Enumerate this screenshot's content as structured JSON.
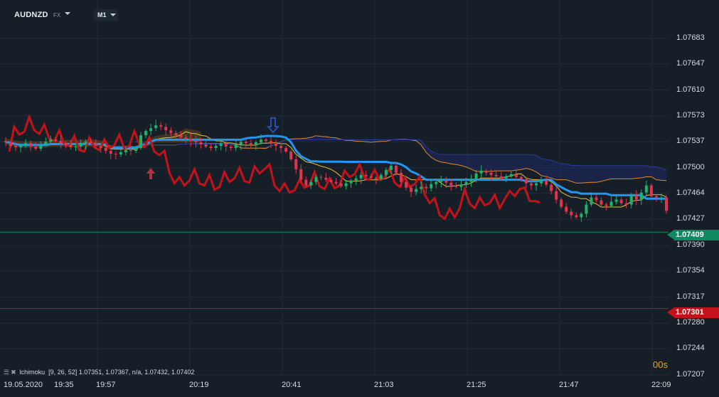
{
  "header": {
    "symbol": "AUDNZD",
    "market": "FX",
    "timeframe": "M1"
  },
  "price_scale": [
    "1.07683",
    "1.07647",
    "1.07610",
    "1.07573",
    "1.07537",
    "1.07500",
    "1.07464",
    "1.07427",
    "1.07390",
    "1.07354",
    "1.07317",
    "1.07280",
    "1.07244",
    "1.07207"
  ],
  "time_axis": [
    "19.05.2020",
    "19:35",
    "19:57",
    "20:19",
    "20:41",
    "21:03",
    "21:25",
    "21:47",
    "22:09"
  ],
  "current_price": {
    "value": "1.07409",
    "color": "#0e8a62"
  },
  "level_line": {
    "value": "1.07301",
    "color": "#c4121a"
  },
  "countdown": "00s",
  "indicator": {
    "name": "Ichimoku",
    "params": "[9, 26, 52]",
    "values": "1.07351,  1.07367,  n/a,  1.07432,  1.07402"
  },
  "colors": {
    "background": "#161e27",
    "bull": "#1db36a",
    "bear": "#e0354a",
    "tenkan": "#e8c13a",
    "kijun": "#2196f3",
    "chikou": "#c4121a",
    "cloud_up": "#6b4a1e",
    "cloud_down": "#1f2a66",
    "span_a": "#e08a2a",
    "span_b": "#2a3a9a"
  },
  "chart_data": {
    "type": "candlestick",
    "x": [
      "19:35",
      "19:57",
      "20:19",
      "20:41",
      "21:03",
      "21:25",
      "21:47",
      "22:09"
    ],
    "ylim": [
      1.07207,
      1.07683
    ],
    "series": [
      {
        "name": "Ichimoku",
        "params": [
          9,
          26,
          52
        ]
      }
    ],
    "closes": [
      1.07536,
      1.07531,
      1.07529,
      1.07532,
      1.07535,
      1.0753,
      1.07527,
      1.07533,
      1.07537,
      1.0754,
      1.07538,
      1.07535,
      1.07532,
      1.07529,
      1.0753,
      1.07534,
      1.07537,
      1.07535,
      1.07531,
      1.07528,
      1.07524,
      1.0752,
      1.07519,
      1.07522,
      1.07525,
      1.07524,
      1.07528,
      1.07546,
      1.07552,
      1.07556,
      1.0756,
      1.07558,
      1.07553,
      1.07549,
      1.07546,
      1.07543,
      1.07541,
      1.07538,
      1.07536,
      1.07533,
      1.0753,
      1.07528,
      1.07531,
      1.07534,
      1.0753,
      1.07528,
      1.07533,
      1.07537,
      1.07535,
      1.07532,
      1.07536,
      1.0754,
      1.07538,
      1.07534,
      1.07531,
      1.07528,
      1.07523,
      1.07512,
      1.07498,
      1.07483,
      1.07475,
      1.0748,
      1.07487,
      1.07486,
      1.07483,
      1.0748,
      1.07478,
      1.07474,
      1.07478,
      1.07482,
      1.07485,
      1.0749,
      1.07488,
      1.07486,
      1.07484,
      1.0749,
      1.07497,
      1.07503,
      1.07493,
      1.0748,
      1.07472,
      1.07466,
      1.0747,
      1.07473,
      1.07471,
      1.07477,
      1.0748,
      1.07482,
      1.07479,
      1.07475,
      1.07473,
      1.07476,
      1.0748,
      1.07484,
      1.07492,
      1.07496,
      1.07493,
      1.0749,
      1.07488,
      1.07485,
      1.07488,
      1.07491,
      1.07487,
      1.07484,
      1.07478,
      1.07475,
      1.07478,
      1.07482,
      1.07476,
      1.07467,
      1.07455,
      1.07445,
      1.07438,
      1.07433,
      1.0743,
      1.07435,
      1.07448,
      1.07458,
      1.07454,
      1.07448,
      1.07446,
      1.07452,
      1.07455,
      1.0745,
      1.07448,
      1.07461,
      1.07455,
      1.07465,
      1.07475,
      1.0746,
      1.07458,
      1.07458,
      1.07439
    ]
  }
}
